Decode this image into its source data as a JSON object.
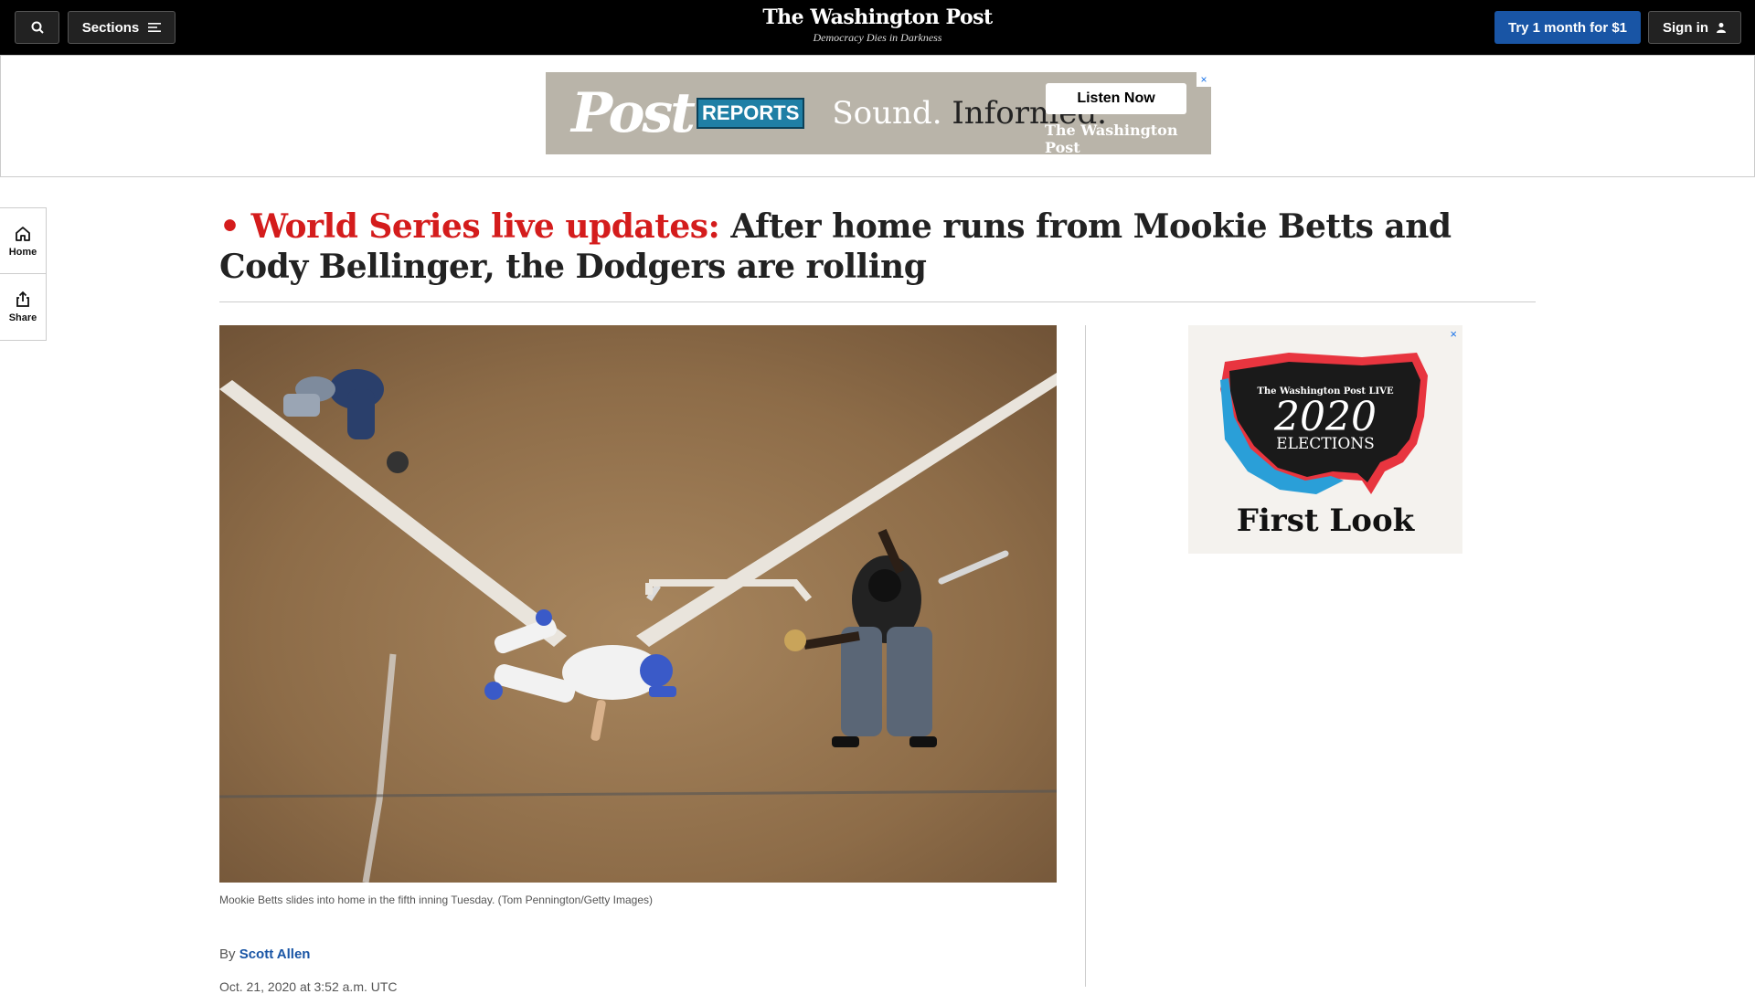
{
  "nav": {
    "sections_label": "Sections",
    "logo": "The Washington Post",
    "tagline": "Democracy Dies in Darkness",
    "try_label": "Try 1 month for $1",
    "signin_label": "Sign in"
  },
  "ad_top": {
    "post": "Post",
    "reports": "REPORTS",
    "slogan_a": "Sound.",
    "slogan_b": "Informed.",
    "cta": "Listen Now",
    "brand": "The Washington Post",
    "close": "×"
  },
  "rail": {
    "home_label": "Home",
    "share_label": "Share"
  },
  "article": {
    "bullet": "•",
    "live_label": "World Series live updates:",
    "headline": "After home runs from Mookie Betts and Cody Bellinger, the Dodgers are rolling",
    "caption": "Mookie Betts slides into home in the fifth inning Tuesday. (Tom Pennington/Getty Images)",
    "by": "By",
    "author": "Scott Allen",
    "date": "Oct. 21, 2020 at 3:52 a.m. UTC"
  },
  "ad_right": {
    "close": "×",
    "wp_live": "The Washington Post LIVE",
    "year": "2020",
    "elections": "ELECTIONS",
    "first_look": "First Look"
  }
}
